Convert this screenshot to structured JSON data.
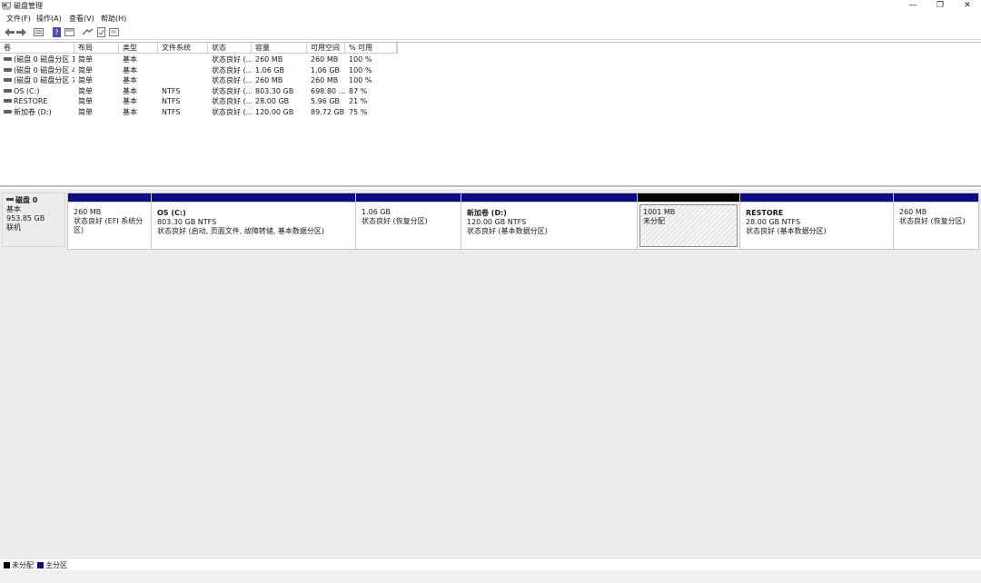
{
  "window": {
    "title": "磁盘管理",
    "minimize": "—",
    "maximize": "❐",
    "close": "✕"
  },
  "menu": [
    "文件(F)",
    "操作(A)",
    "查看(V)",
    "帮助(H)"
  ],
  "toolbar": {
    "icons": [
      "back-arrow-icon",
      "forward-arrow-icon",
      "volume-list-icon",
      "help-icon",
      "graph-view-icon",
      "settings-icon",
      "properties-icon",
      "document-icon"
    ]
  },
  "volume_list": {
    "columns": [
      "卷",
      "布局",
      "类型",
      "文件系统",
      "状态",
      "容量",
      "可用空间",
      "% 可用"
    ],
    "rows": [
      {
        "volume": "(磁盘 0 磁盘分区 1)",
        "layout": "简单",
        "type": "基本",
        "fs": "",
        "status": "状态良好 (...",
        "capacity": "260 MB",
        "free": "260 MB",
        "pct": "100 %"
      },
      {
        "volume": "(磁盘 0 磁盘分区 4)",
        "layout": "简单",
        "type": "基本",
        "fs": "",
        "status": "状态良好 (...",
        "capacity": "1.06 GB",
        "free": "1.06 GB",
        "pct": "100 %"
      },
      {
        "volume": "(磁盘 0 磁盘分区 7)",
        "layout": "简单",
        "type": "基本",
        "fs": "",
        "status": "状态良好 (...",
        "capacity": "260 MB",
        "free": "260 MB",
        "pct": "100 %"
      },
      {
        "volume": "OS (C:)",
        "layout": "简单",
        "type": "基本",
        "fs": "NTFS",
        "status": "状态良好 (...",
        "capacity": "803.30 GB",
        "free": "698.80 ...",
        "pct": "87 %"
      },
      {
        "volume": "RESTORE",
        "layout": "简单",
        "type": "基本",
        "fs": "NTFS",
        "status": "状态良好 (...",
        "capacity": "28.00 GB",
        "free": "5.96 GB",
        "pct": "21 %"
      },
      {
        "volume": "新加卷 (D:)",
        "layout": "简单",
        "type": "基本",
        "fs": "NTFS",
        "status": "状态良好 (...",
        "capacity": "120.00 GB",
        "free": "89.72 GB",
        "pct": "75 %"
      }
    ]
  },
  "disk": {
    "name": "磁盘 0",
    "type": "基本",
    "size": "953.85 GB",
    "state": "联机"
  },
  "partitions": [
    {
      "name": "",
      "size": "260 MB",
      "status": "状态良好 (EFI 系统分区)",
      "kind": "primary"
    },
    {
      "name": "OS  (C:)",
      "size": "803.30 GB NTFS",
      "status": "状态良好 (启动, 页面文件, 故障转储, 基本数据分区)",
      "kind": "primary"
    },
    {
      "name": "",
      "size": "1.06 GB",
      "status": "状态良好 (恢复分区)",
      "kind": "primary"
    },
    {
      "name": "新加卷  (D:)",
      "size": "120.00 GB NTFS",
      "status": "状态良好 (基本数据分区)",
      "kind": "primary"
    },
    {
      "name": "",
      "size": "1001 MB",
      "status": "未分配",
      "kind": "unallocated"
    },
    {
      "name": "RESTORE",
      "size": "28.00 GB NTFS",
      "status": "状态良好 (基本数据分区)",
      "kind": "primary"
    },
    {
      "name": "",
      "size": "260 MB",
      "status": "状态良好 (恢复分区)",
      "kind": "primary"
    }
  ],
  "legend": [
    {
      "label": "未分配",
      "color": "#000000"
    },
    {
      "label": "主分区",
      "color": "#0b0b7f"
    }
  ]
}
